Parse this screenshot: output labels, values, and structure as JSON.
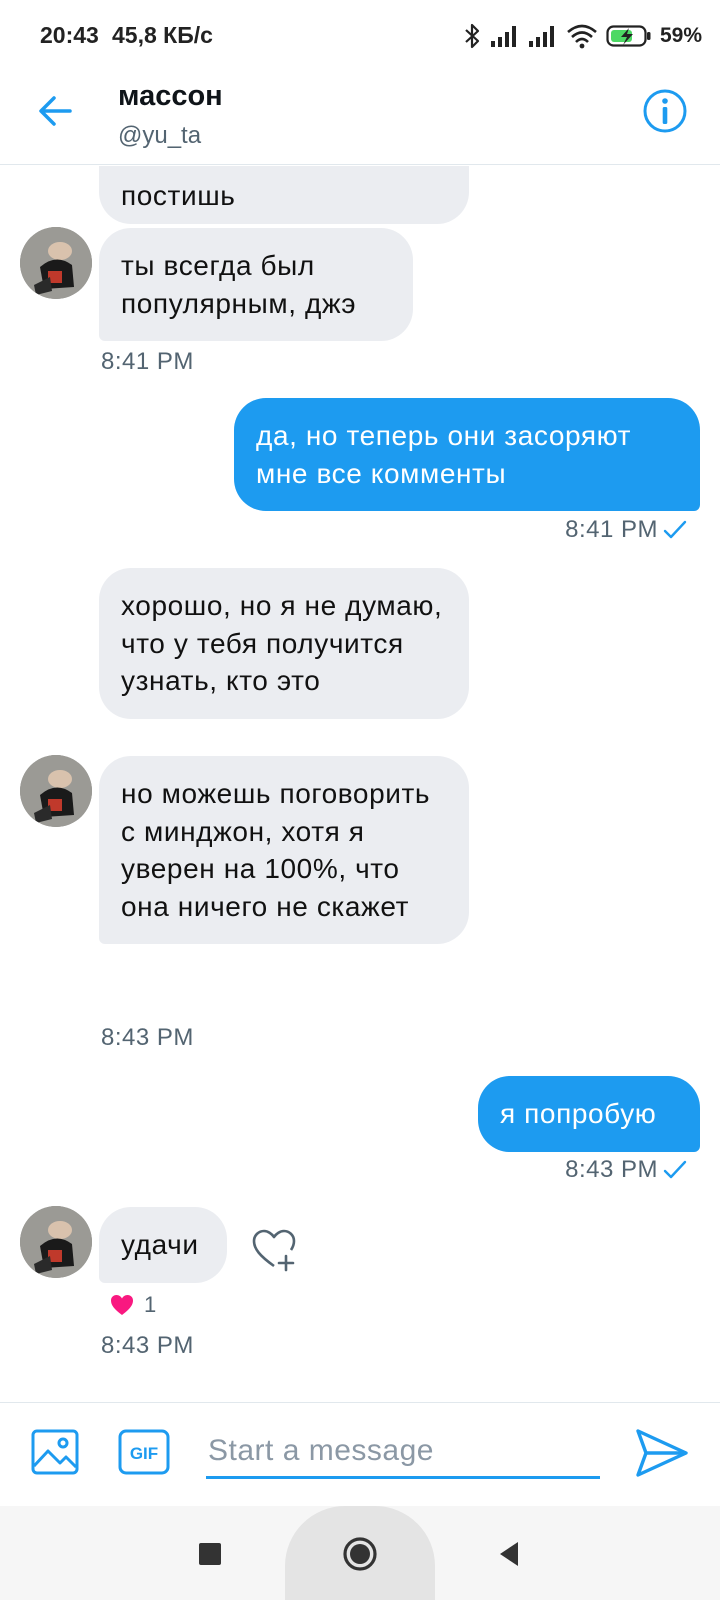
{
  "status_bar": {
    "time": "20:43",
    "speed": "45,8 КБ/с",
    "battery": "59%",
    "icons": [
      "bluetooth-icon",
      "signal-icon",
      "signal-icon",
      "wifi-icon",
      "battery-charging-icon"
    ]
  },
  "header": {
    "name": "массон",
    "handle": "@yu_ta"
  },
  "messages": [
    {
      "side": "in",
      "text": "постишь"
    },
    {
      "side": "in",
      "text": "ты всегда был популярным, джэ"
    },
    {
      "side": "in",
      "time": "8:41 PM"
    },
    {
      "side": "out",
      "text": "да, но теперь они засоряют мне все комменты",
      "time": "8:41 PM"
    },
    {
      "side": "in",
      "text": "хорошо, но я не думаю, что у тебя получится узнать, кто это"
    },
    {
      "side": "in",
      "text": "но можешь поговорить с минджон, хотя я уверен на 100%, что она ничего не скажет",
      "time": "8:43 PM"
    },
    {
      "side": "out",
      "text": "я попробую",
      "time": "8:43 PM"
    },
    {
      "side": "in",
      "text": "удачи",
      "reaction_count": "1",
      "time": "8:43 PM"
    }
  ],
  "ts": {
    "a": "8:41 PM",
    "b": "8:41 PM",
    "c": "8:43 PM",
    "d": "8:43 PM",
    "e": "8:43 PM"
  },
  "composer": {
    "placeholder": "Start a message",
    "gif_label": "GIF"
  },
  "colors": {
    "accent": "#1d9bf0",
    "incoming_bubble": "#ebedf1",
    "heart": "#f91880"
  }
}
